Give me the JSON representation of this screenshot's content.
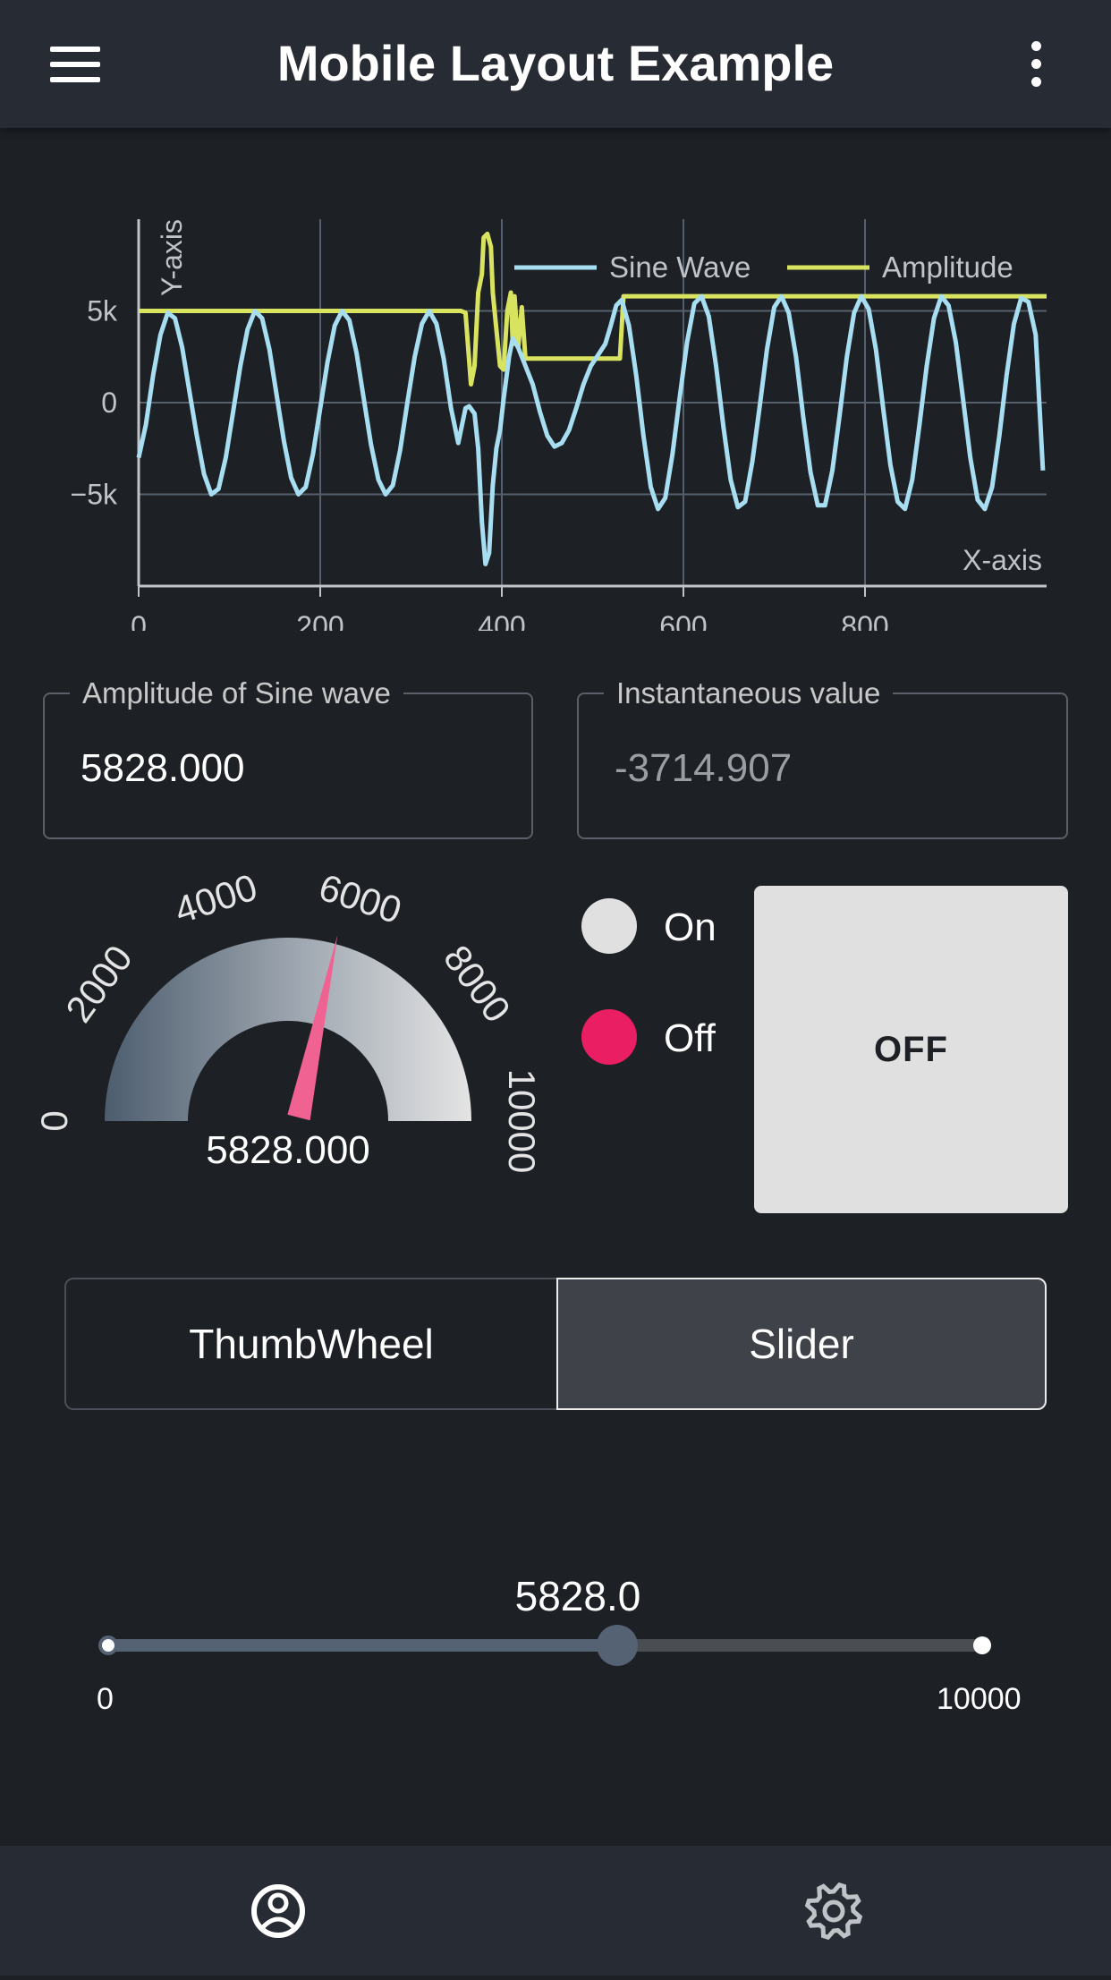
{
  "appbar": {
    "title": "Mobile Layout Example",
    "menu_icon": "hamburger-menu-icon",
    "more_icon": "more-vertical-icon"
  },
  "chart_data": {
    "type": "line",
    "xlabel": "X-axis",
    "ylabel": "Y-axis",
    "xlim": [
      0,
      1000
    ],
    "ylim": [
      -10000,
      10000
    ],
    "x_ticks": [
      "0",
      "200",
      "400",
      "600",
      "800"
    ],
    "y_ticks": [
      "5k",
      "0",
      "−5k"
    ],
    "grid": true,
    "legend_position": "top-right",
    "series": [
      {
        "name": "Sine Wave",
        "color": "#a8def2",
        "points": [
          [
            0,
            -3000
          ],
          [
            8,
            -1200
          ],
          [
            16,
            1500
          ],
          [
            24,
            3700
          ],
          [
            32,
            4900
          ],
          [
            40,
            4600
          ],
          [
            48,
            3000
          ],
          [
            56,
            600
          ],
          [
            64,
            -1800
          ],
          [
            72,
            -3900
          ],
          [
            80,
            -5000
          ],
          [
            88,
            -4700
          ],
          [
            96,
            -3000
          ],
          [
            104,
            -500
          ],
          [
            112,
            2000
          ],
          [
            120,
            4000
          ],
          [
            128,
            5000
          ],
          [
            136,
            4600
          ],
          [
            144,
            2900
          ],
          [
            152,
            400
          ],
          [
            160,
            -2100
          ],
          [
            168,
            -4100
          ],
          [
            176,
            -5000
          ],
          [
            184,
            -4600
          ],
          [
            192,
            -2800
          ],
          [
            200,
            -300
          ],
          [
            208,
            2200
          ],
          [
            216,
            4200
          ],
          [
            224,
            5000
          ],
          [
            232,
            4500
          ],
          [
            240,
            2700
          ],
          [
            248,
            200
          ],
          [
            256,
            -2300
          ],
          [
            264,
            -4200
          ],
          [
            272,
            -5000
          ],
          [
            280,
            -4500
          ],
          [
            288,
            -2600
          ],
          [
            296,
            0
          ],
          [
            304,
            2500
          ],
          [
            312,
            4300
          ],
          [
            320,
            5000
          ],
          [
            328,
            4300
          ],
          [
            336,
            2400
          ],
          [
            344,
            -300
          ],
          [
            352,
            -2200
          ],
          [
            360,
            -300
          ],
          [
            364,
            -200
          ],
          [
            370,
            -600
          ],
          [
            374,
            -2500
          ],
          [
            378,
            -6500
          ],
          [
            382,
            -8800
          ],
          [
            386,
            -8200
          ],
          [
            390,
            -4500
          ],
          [
            394,
            -2500
          ],
          [
            398,
            -1500
          ],
          [
            402,
            200
          ],
          [
            408,
            2500
          ],
          [
            412,
            3500
          ],
          [
            418,
            3000
          ],
          [
            426,
            2000
          ],
          [
            434,
            1000
          ],
          [
            442,
            -500
          ],
          [
            450,
            -1800
          ],
          [
            458,
            -2400
          ],
          [
            466,
            -2200
          ],
          [
            474,
            -1500
          ],
          [
            482,
            -300
          ],
          [
            490,
            1000
          ],
          [
            498,
            2000
          ],
          [
            506,
            2600
          ],
          [
            514,
            3200
          ],
          [
            520,
            4200
          ],
          [
            526,
            5300
          ],
          [
            532,
            5600
          ],
          [
            540,
            4200
          ],
          [
            548,
            1500
          ],
          [
            556,
            -1800
          ],
          [
            564,
            -4600
          ],
          [
            572,
            -5800
          ],
          [
            580,
            -5200
          ],
          [
            588,
            -2800
          ],
          [
            596,
            300
          ],
          [
            604,
            3300
          ],
          [
            612,
            5400
          ],
          [
            620,
            5800
          ],
          [
            628,
            4700
          ],
          [
            636,
            2000
          ],
          [
            644,
            -1300
          ],
          [
            652,
            -4200
          ],
          [
            660,
            -5700
          ],
          [
            668,
            -5400
          ],
          [
            676,
            -3200
          ],
          [
            684,
            -200
          ],
          [
            692,
            2900
          ],
          [
            700,
            5200
          ],
          [
            708,
            5800
          ],
          [
            716,
            4900
          ],
          [
            724,
            2500
          ],
          [
            732,
            -800
          ],
          [
            740,
            -3800
          ],
          [
            748,
            -5600
          ],
          [
            756,
            -5600
          ],
          [
            764,
            -3700
          ],
          [
            772,
            -700
          ],
          [
            780,
            2500
          ],
          [
            788,
            4900
          ],
          [
            796,
            5800
          ],
          [
            804,
            5100
          ],
          [
            812,
            2900
          ],
          [
            820,
            -300
          ],
          [
            828,
            -3400
          ],
          [
            836,
            -5400
          ],
          [
            844,
            -5800
          ],
          [
            852,
            -4200
          ],
          [
            860,
            -1200
          ],
          [
            868,
            2000
          ],
          [
            876,
            4600
          ],
          [
            884,
            5800
          ],
          [
            892,
            5300
          ],
          [
            900,
            3300
          ],
          [
            908,
            200
          ],
          [
            916,
            -3000
          ],
          [
            924,
            -5300
          ],
          [
            932,
            -5800
          ],
          [
            940,
            -4600
          ],
          [
            948,
            -1800
          ],
          [
            956,
            1500
          ],
          [
            964,
            4300
          ],
          [
            972,
            5700
          ],
          [
            980,
            5500
          ],
          [
            988,
            3700
          ],
          [
            996,
            -3700
          ]
        ]
      },
      {
        "name": "Amplitude",
        "color": "#d8e35f",
        "points": [
          [
            0,
            5000
          ],
          [
            355,
            5000
          ],
          [
            360,
            4900
          ],
          [
            366,
            1000
          ],
          [
            370,
            2000
          ],
          [
            374,
            6000
          ],
          [
            378,
            7000
          ],
          [
            380,
            9000
          ],
          [
            384,
            9200
          ],
          [
            388,
            8500
          ],
          [
            390,
            6000
          ],
          [
            394,
            4000
          ],
          [
            398,
            2000
          ],
          [
            402,
            1800
          ],
          [
            406,
            5000
          ],
          [
            410,
            6000
          ],
          [
            412,
            3200
          ],
          [
            414,
            5800
          ],
          [
            418,
            3000
          ],
          [
            422,
            5200
          ],
          [
            426,
            2400
          ],
          [
            480,
            2400
          ],
          [
            530,
            2400
          ],
          [
            534,
            5800
          ],
          [
            1000,
            5800
          ]
        ]
      }
    ]
  },
  "fields": {
    "amplitude": {
      "label": "Amplitude of Sine wave",
      "value": "5828.000"
    },
    "instantaneous": {
      "label": "Instantaneous value",
      "value": "-3714.907"
    }
  },
  "gauge": {
    "min": 0,
    "max": 10000,
    "value": 5828,
    "value_text": "5828.000",
    "tick_labels": [
      "0",
      "2000",
      "4000",
      "6000",
      "8000",
      "10000"
    ],
    "needle_color": "#f06292"
  },
  "radios": [
    {
      "label": "On",
      "color": "#e0e0e0",
      "icon": "radio-circle-icon"
    },
    {
      "label": "Off",
      "color": "#e91e63",
      "icon": "radio-circle-icon"
    }
  ],
  "toggle_button": {
    "label": "OFF"
  },
  "segmented": {
    "left": "ThumbWheel",
    "right": "Slider",
    "selected": "Slider"
  },
  "slider": {
    "value_text": "5828.0",
    "min_label": "0",
    "max_label": "10000",
    "value": 5828,
    "min": 0,
    "max": 10000
  },
  "bottom_nav": {
    "tab1_icon": "account-circle-icon",
    "tab2_icon": "gear-icon",
    "active_color": "#a6dcf3"
  }
}
